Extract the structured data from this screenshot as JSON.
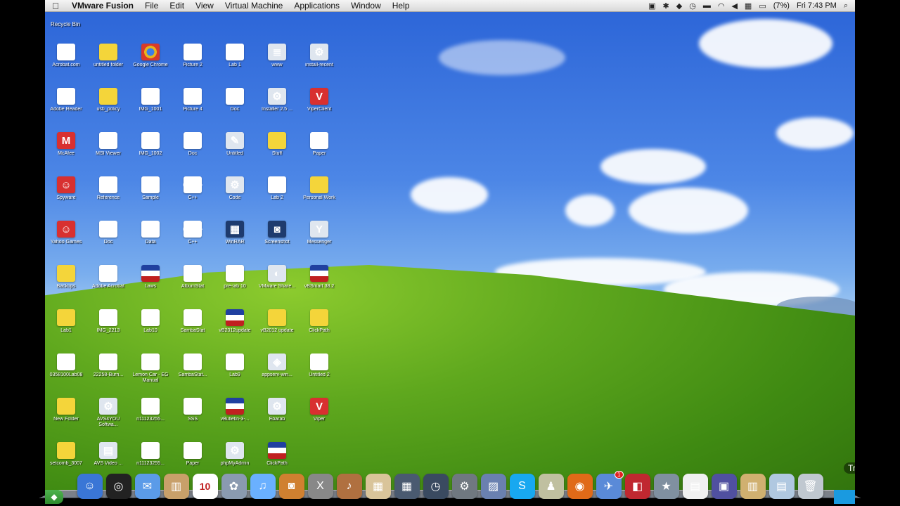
{
  "menubar": {
    "apple": "",
    "menus": [
      "VMware Fusion",
      "File",
      "Edit",
      "View",
      "Virtual Machine",
      "Applications",
      "Window",
      "Help"
    ],
    "battery": "(7%)",
    "clock": "Fri 7:43 PM"
  },
  "desktop": {
    "recycle_label": "Recycle Bin",
    "icons": [
      {
        "label": "Acrobat.com",
        "kind": "pdf",
        "glyph": "A"
      },
      {
        "label": "untitled folder",
        "kind": "folder",
        "glyph": ""
      },
      {
        "label": "Google Chrome",
        "kind": "chrome",
        "glyph": ""
      },
      {
        "label": "Picture 2",
        "kind": "doc",
        "glyph": "▣"
      },
      {
        "label": "Lab 1",
        "kind": "doc",
        "glyph": "W"
      },
      {
        "label": "www",
        "kind": "app",
        "glyph": "≣"
      },
      {
        "label": "install-recent",
        "kind": "app",
        "glyph": "⚙"
      },
      {
        "label": "Adobe Reader",
        "kind": "pdf",
        "glyph": "A"
      },
      {
        "label": "usb_policy",
        "kind": "folder",
        "glyph": ""
      },
      {
        "label": "IMG_1001",
        "kind": "doc",
        "glyph": "▤"
      },
      {
        "label": "Picture 4",
        "kind": "doc",
        "glyph": "▣"
      },
      {
        "label": "Doc",
        "kind": "doc",
        "glyph": "≡"
      },
      {
        "label": "Installer 2.5 ...",
        "kind": "app",
        "glyph": "⚙"
      },
      {
        "label": "ViperClient",
        "kind": "red",
        "glyph": "V"
      },
      {
        "label": "McAfee",
        "kind": "red",
        "glyph": "M"
      },
      {
        "label": "MSI Viewer",
        "kind": "pdf",
        "glyph": "▤"
      },
      {
        "label": "IMG_1002",
        "kind": "doc",
        "glyph": "▤"
      },
      {
        "label": "Doc",
        "kind": "doc",
        "glyph": "▤"
      },
      {
        "label": "Untitled",
        "kind": "app",
        "glyph": "✎"
      },
      {
        "label": "Stuff",
        "kind": "folder",
        "glyph": ""
      },
      {
        "label": "Paper",
        "kind": "doc",
        "glyph": "▤"
      },
      {
        "label": "Spyware",
        "kind": "red",
        "glyph": "☺"
      },
      {
        "label": "Reference",
        "kind": "pdf",
        "glyph": "▤"
      },
      {
        "label": "Sample",
        "kind": "doc",
        "glyph": "▤"
      },
      {
        "label": "C++",
        "kind": "doc",
        "glyph": "C++"
      },
      {
        "label": "Code",
        "kind": "app",
        "glyph": "⚙"
      },
      {
        "label": "Lab 2",
        "kind": "doc",
        "glyph": "▤"
      },
      {
        "label": "Personal Work",
        "kind": "folder",
        "glyph": ""
      },
      {
        "label": "Yahoo Games",
        "kind": "red",
        "glyph": "☺"
      },
      {
        "label": "Doc",
        "kind": "doc",
        "glyph": "▤"
      },
      {
        "label": "Data",
        "kind": "doc",
        "glyph": "▤"
      },
      {
        "label": "C++",
        "kind": "doc",
        "glyph": "C++"
      },
      {
        "label": "WinRAR",
        "kind": "dark",
        "glyph": "▦"
      },
      {
        "label": "Screenshot",
        "kind": "dark",
        "glyph": "◙"
      },
      {
        "label": "Messenger",
        "kind": "app",
        "glyph": "Y"
      },
      {
        "label": "Backups",
        "kind": "folder",
        "glyph": ""
      },
      {
        "label": "Adobe Acrobat",
        "kind": "pdf",
        "glyph": "▤"
      },
      {
        "label": "Laws",
        "kind": "flag",
        "glyph": ""
      },
      {
        "label": "AlbumStat",
        "kind": "doc",
        "glyph": "▤"
      },
      {
        "label": "pre-lab 10",
        "kind": "doc",
        "glyph": "W"
      },
      {
        "label": "VMware Share...",
        "kind": "app",
        "glyph": "◐"
      },
      {
        "label": "vBSmart 38.2",
        "kind": "flag",
        "glyph": ""
      },
      {
        "label": "Lab1",
        "kind": "folder",
        "glyph": ""
      },
      {
        "label": "IMG_2213",
        "kind": "doc",
        "glyph": "▤"
      },
      {
        "label": "Lab10",
        "kind": "doc",
        "glyph": "W"
      },
      {
        "label": "SambaStat",
        "kind": "doc",
        "glyph": "▤"
      },
      {
        "label": "vB2012update",
        "kind": "flag",
        "glyph": ""
      },
      {
        "label": "vB2012 update",
        "kind": "folder",
        "glyph": ""
      },
      {
        "label": "ClickPath",
        "kind": "folder",
        "glyph": ""
      },
      {
        "label": "0358100Lab08",
        "kind": "doc",
        "glyph": "W"
      },
      {
        "label": "22258-Burn...",
        "kind": "doc",
        "glyph": "▤"
      },
      {
        "label": "Lemon Car - EG Manual",
        "kind": "pdf",
        "glyph": "▤"
      },
      {
        "label": "SambaStat...",
        "kind": "doc",
        "glyph": "◐"
      },
      {
        "label": "Lab9",
        "kind": "doc",
        "glyph": "W"
      },
      {
        "label": "appserv-win...",
        "kind": "app",
        "glyph": "◈"
      },
      {
        "label": "Untitled 2",
        "kind": "doc",
        "glyph": "W"
      },
      {
        "label": "New Folder",
        "kind": "folder",
        "glyph": ""
      },
      {
        "label": "AVS4YOU Softwa...",
        "kind": "app",
        "glyph": "⚙"
      },
      {
        "label": "n11123255...",
        "kind": "doc",
        "glyph": "▤"
      },
      {
        "label": "SSS",
        "kind": "doc",
        "glyph": "▤"
      },
      {
        "label": "vBulletin-3-...",
        "kind": "flag",
        "glyph": ""
      },
      {
        "label": "Ebarab",
        "kind": "app",
        "glyph": "⚙"
      },
      {
        "label": "Viper",
        "kind": "red",
        "glyph": "V"
      },
      {
        "label": "setcomb_3007",
        "kind": "folder",
        "glyph": ""
      },
      {
        "label": "AVS Video ...",
        "kind": "app",
        "glyph": "▤"
      },
      {
        "label": "n11123255...",
        "kind": "doc",
        "glyph": "▤"
      },
      {
        "label": "Paper",
        "kind": "doc",
        "glyph": "▤"
      },
      {
        "label": "phpMyAdmin",
        "kind": "app",
        "glyph": "⚙"
      },
      {
        "label": "ClickPath",
        "kind": "flag",
        "glyph": ""
      }
    ]
  },
  "dock": {
    "trash_label": "Trash",
    "calendar_day": "10",
    "mail_badge": "1",
    "items": [
      {
        "name": "finder",
        "bg": "#3a76d6",
        "glyph": "☺"
      },
      {
        "name": "dashboard",
        "bg": "#222222",
        "glyph": "◎"
      },
      {
        "name": "ichat",
        "bg": "#5b9be8",
        "glyph": "✉"
      },
      {
        "name": "address-book",
        "bg": "#c8a06a",
        "glyph": "▥"
      },
      {
        "name": "ical",
        "bg": "#ffffff",
        "glyph": ""
      },
      {
        "name": "iphoto",
        "bg": "#8a9ab0",
        "glyph": "✿"
      },
      {
        "name": "itunes",
        "bg": "#6ab0ff",
        "glyph": "♫"
      },
      {
        "name": "photo-booth",
        "bg": "#d08030",
        "glyph": "◙"
      },
      {
        "name": "x11",
        "bg": "#888888",
        "glyph": "X"
      },
      {
        "name": "garageband",
        "bg": "#b07040",
        "glyph": "♪"
      },
      {
        "name": "preview",
        "bg": "#d9c49a",
        "glyph": "▦"
      },
      {
        "name": "spaces",
        "bg": "#4a5a70",
        "glyph": "▦"
      },
      {
        "name": "time-machine",
        "bg": "#3a4a60",
        "glyph": "◷"
      },
      {
        "name": "system-preferences",
        "bg": "#707880",
        "glyph": "⚙"
      },
      {
        "name": "vmware",
        "bg": "#6a80b0",
        "glyph": "▨"
      },
      {
        "name": "skype",
        "bg": "#18a8f0",
        "glyph": "S"
      },
      {
        "name": "automator",
        "bg": "#c0c0a0",
        "glyph": "♟"
      },
      {
        "name": "firefox",
        "bg": "#e06a18",
        "glyph": "◉"
      },
      {
        "name": "mail",
        "bg": "#5a8ad8",
        "glyph": "✈"
      },
      {
        "name": "photobooth-red",
        "bg": "#c02830",
        "glyph": "◧"
      },
      {
        "name": "imovie",
        "bg": "#8090a0",
        "glyph": "★"
      },
      {
        "name": "document",
        "bg": "#f0f0f0",
        "glyph": "▤"
      },
      {
        "name": "stack",
        "bg": "#5050a0",
        "glyph": "▣"
      },
      {
        "name": "downloads",
        "bg": "#d0b070",
        "glyph": "▥"
      },
      {
        "name": "applications-stack",
        "bg": "#b0c8e0",
        "glyph": "▤"
      },
      {
        "name": "trash",
        "bg": "#c0c8d0",
        "glyph": "🗑"
      }
    ]
  }
}
